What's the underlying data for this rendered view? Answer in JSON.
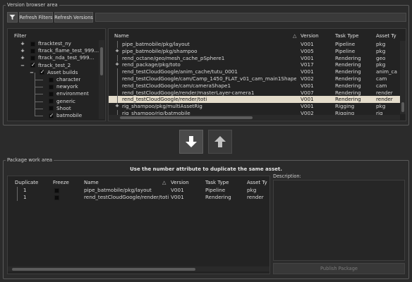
{
  "version_browser": {
    "title": "Version browser area",
    "filter_icon": "funnel-icon",
    "refresh_filters_label": "Refresh Filters",
    "refresh_versions_label": "Refresh Versions",
    "search_value": ""
  },
  "filter_tree": {
    "header": "Filter",
    "items": [
      {
        "label": "ftracktest_ny",
        "expand": "+",
        "checked": false,
        "depth": 0
      },
      {
        "label": "ftrack_flame_test_999...",
        "expand": "+",
        "checked": false,
        "depth": 0
      },
      {
        "label": "ftrack_nda_test_999...",
        "expand": "+",
        "checked": false,
        "depth": 0
      },
      {
        "label": "ftrack_test_2",
        "expand": "−",
        "checked": true,
        "depth": 0
      },
      {
        "label": "Asset builds",
        "expand": "−",
        "checked": true,
        "depth": 1
      },
      {
        "label": "character",
        "expand": "",
        "checked": false,
        "depth": 2
      },
      {
        "label": "newyork",
        "expand": "",
        "checked": false,
        "depth": 2
      },
      {
        "label": "environment",
        "expand": "",
        "checked": false,
        "depth": 2
      },
      {
        "label": "generic",
        "expand": "",
        "checked": false,
        "depth": 2
      },
      {
        "label": "Shoot",
        "expand": "",
        "checked": false,
        "depth": 2
      },
      {
        "label": "batmobile",
        "expand": "",
        "checked": true,
        "depth": 2
      }
    ]
  },
  "version_table": {
    "columns": [
      "Name",
      "Version",
      "Task Type",
      "Asset Ty"
    ],
    "sort_indicator": "△",
    "rows": [
      {
        "expand": "",
        "name": "pipe_batmobile/pkg/layout",
        "version": "V001",
        "task": "Pipeline",
        "asset": "pkg",
        "selected": false
      },
      {
        "expand": "+",
        "name": "pipe_batmobile/pkg/shampoo",
        "version": "V005",
        "task": "Pipeline",
        "asset": "pkg",
        "selected": false
      },
      {
        "expand": "",
        "name": "rend_octane/geo/mesh_cache_pSphere1",
        "version": "V001",
        "task": "Rendering",
        "asset": "geo",
        "selected": false
      },
      {
        "expand": "+",
        "name": "rend_package/pkg/toto",
        "version": "V017",
        "task": "Rendering",
        "asset": "pkg",
        "selected": false
      },
      {
        "expand": "",
        "name": "rend_testCloudGoogle/anim_cache/tutu_0001",
        "version": "V001",
        "task": "Rendering",
        "asset": "anim_ca",
        "selected": false
      },
      {
        "expand": "",
        "name": "rend_testCloudGoogle/cam/Camp_1450_FLAT_v01_cam_main1Shape",
        "version": "V002",
        "task": "Rendering",
        "asset": "cam",
        "selected": false
      },
      {
        "expand": "",
        "name": "rend_testCloudGoogle/cam/cameraShape1",
        "version": "V001",
        "task": "Rendering",
        "asset": "cam",
        "selected": false
      },
      {
        "expand": "",
        "name": "rend_testCloudGoogle/render/masterLayer-camera1",
        "version": "V007",
        "task": "Rendering",
        "asset": "render",
        "selected": false
      },
      {
        "expand": "",
        "name": "rend_testCloudGoogle/render/toti",
        "version": "V001",
        "task": "Rendering",
        "asset": "render",
        "selected": true
      },
      {
        "expand": "+",
        "name": "rig_shampoo/pkg/multiAssetRig",
        "version": "V001",
        "task": "Rigging",
        "asset": "pkg",
        "selected": false
      },
      {
        "expand": "",
        "name": "rig_shampoo/rig/batmobile",
        "version": "V002",
        "task": "Rigging",
        "asset": "rig",
        "selected": false
      }
    ]
  },
  "transfer": {
    "down_icon": "arrow-down-icon",
    "up_icon": "arrow-up-icon"
  },
  "package_area": {
    "title": "Package work area",
    "hint": "Use the number attribute to duplicate the same asset.",
    "columns": [
      "Duplicate",
      "Freeze",
      "Name",
      "Version",
      "Task Type",
      "Asset Ty"
    ],
    "sort_indicator": "△",
    "rows": [
      {
        "duplicate": "1",
        "freeze": false,
        "name": "pipe_batmobile/pkg/layout",
        "version": "V001",
        "task": "Pipeline",
        "asset": "pkg"
      },
      {
        "duplicate": "1",
        "freeze": false,
        "name": "rend_testCloudGoogle/render/toti",
        "version": "V001",
        "task": "Rendering",
        "asset": "render"
      }
    ],
    "description_label": "Description:",
    "description_value": "",
    "publish_label": "Publish Package"
  }
}
